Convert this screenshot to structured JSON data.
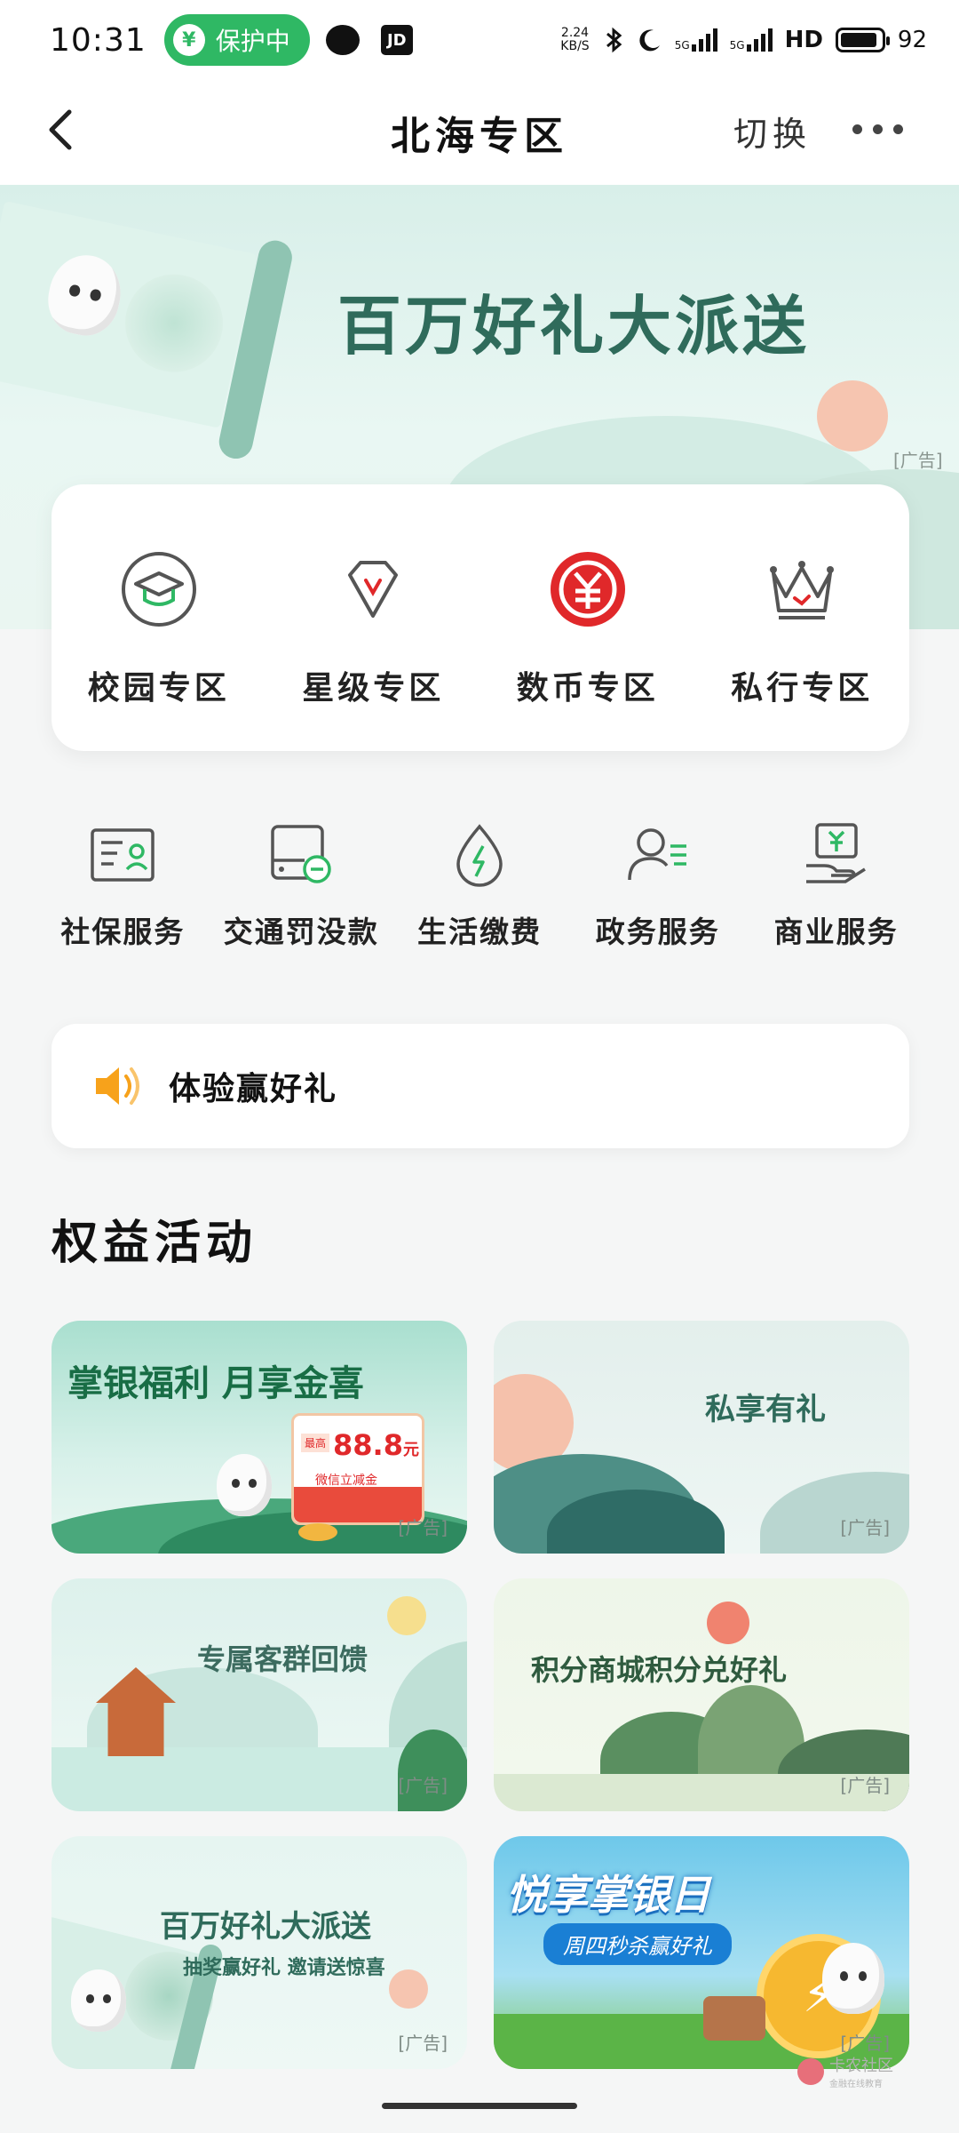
{
  "status_bar": {
    "time": "10:31",
    "protect_label": "保护中",
    "protect_badge": "¥",
    "jd_label": "JD",
    "net_speed_value": "2.24",
    "net_speed_unit": "KB/S",
    "sim1": "5G",
    "sim2": "5G",
    "hd_label": "HD",
    "battery": "92",
    "battery_level": 0.92
  },
  "navbar": {
    "title": "北海专区",
    "switch_label": "切换"
  },
  "banner": {
    "title": "百万好礼大派送",
    "ad_tag": "[广告]"
  },
  "zones": [
    {
      "label": "校园专区",
      "icon": "graduation-cap-icon"
    },
    {
      "label": "星级专区",
      "icon": "diamond-icon"
    },
    {
      "label": "数币专区",
      "icon": "digital-yuan-icon"
    },
    {
      "label": "私行专区",
      "icon": "crown-icon"
    }
  ],
  "services": [
    {
      "label": "社保服务",
      "icon": "social-security-card-icon"
    },
    {
      "label": "交通罚没款",
      "icon": "traffic-fine-icon"
    },
    {
      "label": "生活缴费",
      "icon": "utility-drop-icon"
    },
    {
      "label": "政务服务",
      "icon": "government-user-icon"
    },
    {
      "label": "商业服务",
      "icon": "business-hand-icon"
    }
  ],
  "notice": {
    "text": "体验赢好礼",
    "icon": "speaker-icon"
  },
  "section": {
    "title": "权益活动"
  },
  "activities": [
    {
      "title": "掌银福利 月享金喜",
      "badge": "最高",
      "amount": "88.8",
      "unit": "元",
      "sub": "微信立减金",
      "ad": "[广告]"
    },
    {
      "title": "私享有礼",
      "ad": "[广告]"
    },
    {
      "title": "专属客群回馈",
      "ad": "[广告]"
    },
    {
      "title": "积分商城积分兑好礼",
      "ad": "[广告]"
    },
    {
      "title": "百万好礼大派送",
      "subtitle": "抽奖赢好礼 邀请送惊喜",
      "ad": "[广告]"
    },
    {
      "title": "悦享掌银日",
      "subtitle": "周四秒杀赢好礼",
      "ad": "[广告]"
    }
  ],
  "watermark": {
    "name": "卡农社区",
    "slogan": "金融在线教育"
  },
  "colors": {
    "accent_green": "#2fb864",
    "dark_green": "#2f6b5b",
    "red": "#e0282a"
  }
}
